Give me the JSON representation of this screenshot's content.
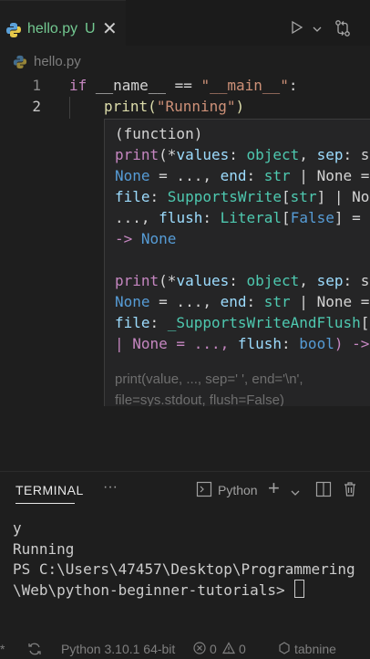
{
  "tab": {
    "filename": "hello.py",
    "status": "U",
    "close": "✕"
  },
  "breadcrumb": {
    "file": "hello.py"
  },
  "editor": {
    "line_numbers": [
      "1",
      "2"
    ],
    "line1": {
      "kw": "if",
      "name": " __name__ ",
      "op": "==",
      "str": " \"__main__\"",
      "colon": ":"
    },
    "line2": {
      "fn": "print",
      "open": "(",
      "str": "\"Running\"",
      "close": ")"
    }
  },
  "hover": {
    "kind": "(function)",
    "sig1": {
      "l1": {
        "fn": "print",
        "a": "(*",
        "p": "values",
        "b": ": ",
        "t": "object",
        "c": ", ",
        "p2": "sep",
        "d": ": s"
      },
      "l2": {
        "a": "None",
        "b": " = ..., ",
        "p": "end",
        "c": ": ",
        "t": "str",
        "d": " | None ="
      },
      "l3": {
        "p": "file",
        "a": ": ",
        "t": "SupportsWrite",
        "b": "[",
        "t2": "str",
        "c": "] | No"
      },
      "l4": {
        "a": "..., ",
        "p": "flush",
        "b": ": ",
        "t": "Literal",
        "c": "[",
        "k": "False",
        "d": "] ="
      },
      "l5": {
        "a": "-> ",
        "t": "None"
      }
    },
    "sig2": {
      "l1": {
        "fn": "print",
        "a": "(*",
        "p": "values",
        "b": ": ",
        "t": "object",
        "c": ", ",
        "p2": "sep",
        "d": ": s"
      },
      "l2": {
        "a": "None",
        "b": " = ..., ",
        "p": "end",
        "c": ": ",
        "t": "str",
        "d": " | None ="
      },
      "l3": {
        "p": "file",
        "a": ": ",
        "t": "_SupportsWriteAndFlush",
        "b": "["
      },
      "l4": {
        "a": "| None = ..., ",
        "p": "flush",
        "b": ": ",
        "t": "bool",
        "c": ") ->"
      }
    },
    "doc1": "print(value, ..., sep=' ', end='\\n',",
    "doc2": "file=sys.stdout, flush=False)"
  },
  "panel": {
    "title": "TERMINAL",
    "more": "···",
    "shell": "Python",
    "plus": "+",
    "output": [
      "y",
      "Running",
      "PS C:\\Users\\47457\\Desktop\\Programmering",
      "\\Web\\python-beginner-tutorials> "
    ]
  },
  "status": {
    "left": "*",
    "python": "Python 3.10.1 64-bit",
    "errors": "0",
    "warnings": "0",
    "ext": "tabnine"
  },
  "colors": {
    "untracked": "#73c991",
    "background": "#1e1e1e",
    "hover_bg": "#252526"
  }
}
